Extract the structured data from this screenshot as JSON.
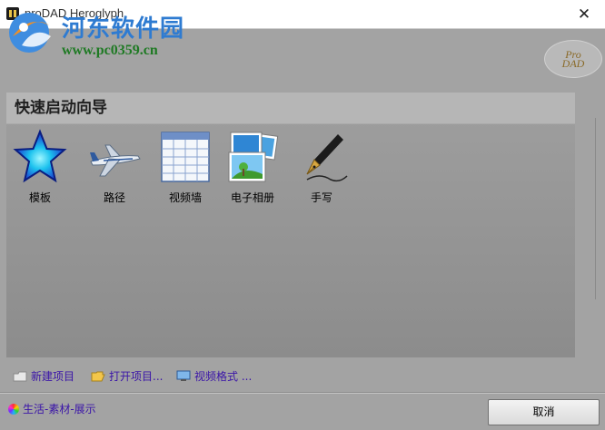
{
  "window": {
    "title": "proDAD Heroglyph",
    "close_glyph": "✕"
  },
  "watermark": {
    "title": "河东软件园",
    "url": "www.pc0359.cn"
  },
  "brand": {
    "logo_text_1": "Pro",
    "logo_text_2": "DAD"
  },
  "wizard": {
    "heading": "快速启动向导",
    "items": [
      {
        "label": "模板",
        "icon": "star-icon"
      },
      {
        "label": "路径",
        "icon": "airplane-icon"
      },
      {
        "label": "视频墙",
        "icon": "grid-table-icon"
      },
      {
        "label": "电子相册",
        "icon": "photo-album-icon"
      },
      {
        "label": "手写",
        "icon": "pen-nib-icon"
      }
    ]
  },
  "actions": {
    "new_project": "新建项目",
    "open_project": "打开项目...",
    "video_format": "视频格式 ..."
  },
  "footer": {
    "gallery_link": "生活-素材-展示",
    "cancel_label": "取消"
  },
  "colors": {
    "link": "#3a14a8",
    "panel_header": "#b6b6b6",
    "panel_body": "#959595",
    "star_blue": "#1b3fd0",
    "watermark_blue": "#2e7bd1",
    "watermark_green": "#1f7a24"
  }
}
